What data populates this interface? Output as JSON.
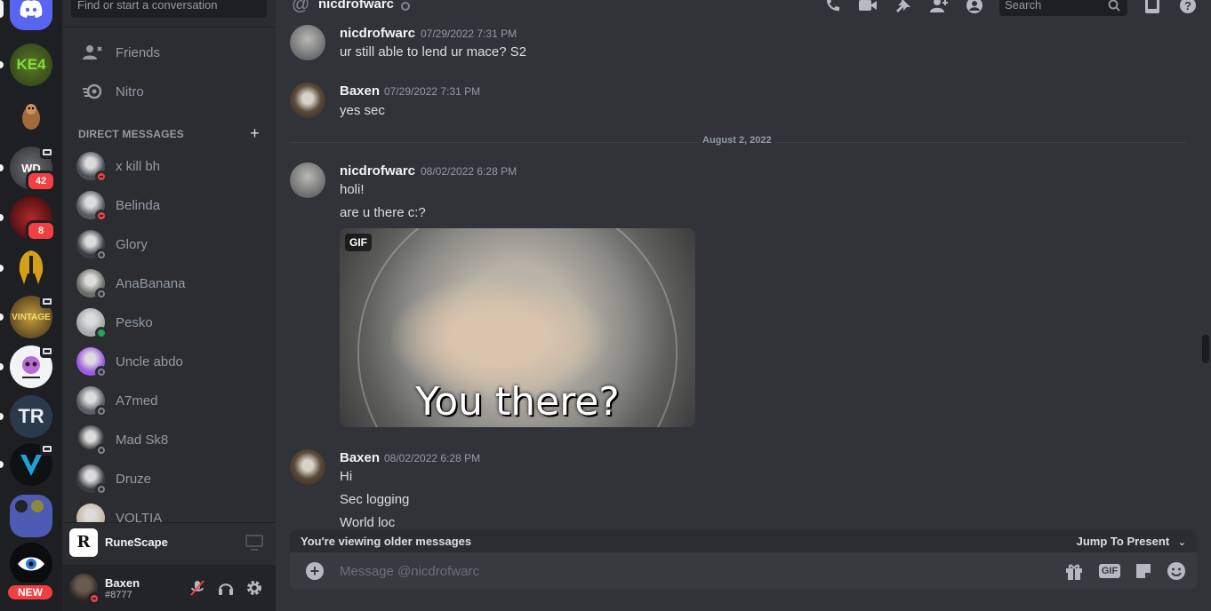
{
  "rail": {
    "new_label": "NEW",
    "servers": [
      {
        "name": "Discord Home",
        "badge": ""
      },
      {
        "name": "KE4",
        "text": "KE4",
        "badge": ""
      },
      {
        "name": "Dog Server",
        "badge": ""
      },
      {
        "name": "WD Server",
        "badge": "42"
      },
      {
        "name": "Reina Server",
        "badge": "8"
      },
      {
        "name": "Spartan Server",
        "badge": ""
      },
      {
        "name": "Vintage Server",
        "badge": ""
      },
      {
        "name": "Pink Skull Server",
        "badge": ""
      },
      {
        "name": "TR Server",
        "text": "TR",
        "badge": ""
      },
      {
        "name": "V Server",
        "badge": ""
      },
      {
        "name": "Emoji Folder",
        "badge": ""
      },
      {
        "name": "Eye Server",
        "badge": ""
      }
    ]
  },
  "sidebar": {
    "search_placeholder": "Find or start a conversation",
    "nav": [
      {
        "label": "Friends",
        "icon": "friends-icon"
      },
      {
        "label": "Nitro",
        "icon": "nitro-icon"
      }
    ],
    "dm_header": "DIRECT MESSAGES",
    "dms": [
      {
        "name": "x kill bh",
        "status": "dnd",
        "color": "#4a4f56"
      },
      {
        "name": "Belinda",
        "status": "dnd",
        "color": "#555a60"
      },
      {
        "name": "Glory",
        "status": "offline",
        "color": "#3c3e42"
      },
      {
        "name": "AnaBanana",
        "status": "offline",
        "color": "#6b6e66"
      },
      {
        "name": "Pesko",
        "status": "online",
        "color": "#a7a9aa"
      },
      {
        "name": "Uncle abdo",
        "status": "offline",
        "color": "#9b5ae0"
      },
      {
        "name": "A7med",
        "status": "offline",
        "color": "#5a5e66"
      },
      {
        "name": "Mad Sk8",
        "status": "offline",
        "color": "#2c2d30"
      },
      {
        "name": "Druze",
        "status": "offline",
        "color": "#3b3c40"
      },
      {
        "name": "VOLTIA",
        "status": "offline",
        "color": "#c6b9a6"
      }
    ],
    "activity": {
      "game": "RuneScape",
      "icon_letter": "R"
    },
    "user": {
      "name": "Baxen",
      "tag": "#8777"
    }
  },
  "header": {
    "channel_name": "nicdrofwarc",
    "search_placeholder": "Search"
  },
  "messages": [
    {
      "author": "nicdrofwarc",
      "time": "07/29/2022 7:31 PM",
      "lines": [
        "ur still able to lend ur mace? S2"
      ]
    },
    {
      "author": "Baxen",
      "time": "07/29/2022 7:31 PM",
      "lines": [
        "yes sec"
      ]
    },
    {
      "author": "nicdrofwarc",
      "time": "08/02/2022 6:28 PM",
      "lines": [
        "holi!",
        "are u there c:?"
      ]
    },
    {
      "author": "Baxen",
      "time": "08/02/2022 6:28 PM",
      "lines": [
        "Hi",
        "Sec logging",
        "World loc"
      ]
    }
  ],
  "date_divider": "August 2, 2022",
  "gif": {
    "tag": "GIF",
    "caption": "You there?"
  },
  "older_bar": {
    "text": "You're viewing older messages",
    "jump": "Jump To Present"
  },
  "composer": {
    "placeholder": "Message @nicdrofwarc",
    "gif_label": "GIF"
  },
  "colors": {
    "accent": "#5865f2",
    "danger": "#f23f42",
    "online": "#23a55a"
  }
}
